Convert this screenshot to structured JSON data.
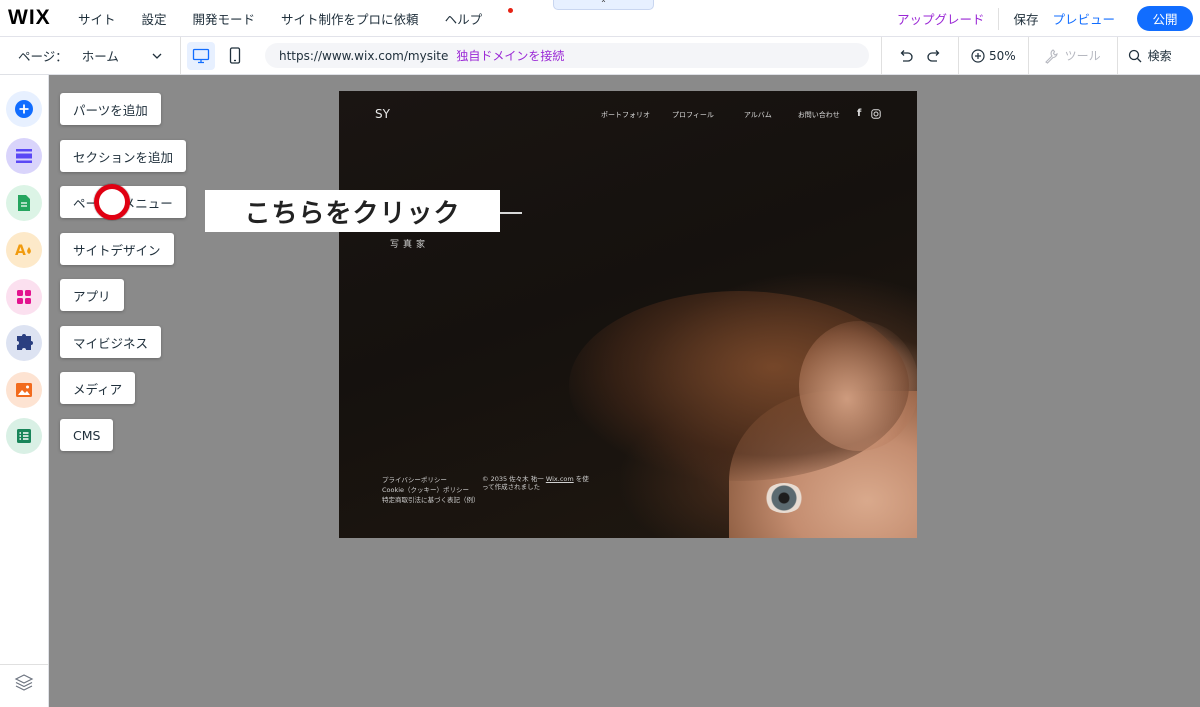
{
  "topbar": {
    "logo": "WIX",
    "menu": [
      "サイト",
      "設定",
      "開発モード",
      "サイト制作をプロに依頼",
      "ヘルプ"
    ],
    "tab_handle_glyph": "⌃",
    "upgrade": "アップグレード",
    "save": "保存",
    "preview": "プレビュー",
    "publish": "公開"
  },
  "toolbar": {
    "page_label": "ページ：",
    "page_value": "ホーム",
    "url": "https://www.wix.com/mysite",
    "connect_domain": "独自ドメインを接続",
    "zoom": "50%",
    "tools": "ツール",
    "search": "検索"
  },
  "rail": {
    "items": [
      {
        "name": "add",
        "color": "#116dff"
      },
      {
        "name": "sections",
        "color": "#5a48f5"
      },
      {
        "name": "pages",
        "color": "#25a55f"
      },
      {
        "name": "design",
        "color": "#f19b0f"
      },
      {
        "name": "apps",
        "color": "#e3128f"
      },
      {
        "name": "business",
        "color": "#2b3f80"
      },
      {
        "name": "media",
        "color": "#f26b1d"
      },
      {
        "name": "cms",
        "color": "#18855a"
      }
    ]
  },
  "panel_buttons": [
    "パーツを追加",
    "セクションを追加",
    "ページ・メニュー",
    "サイトデザイン",
    "アプリ",
    "マイビジネス",
    "メディア",
    "CMS"
  ],
  "callout": "こちらをクリック",
  "site": {
    "logo": "SY",
    "nav": [
      "ポートフォリオ",
      "プロフィール",
      "アルバム",
      "お問い合わせ"
    ],
    "subtitle": "写真家",
    "footer_left": [
      "プライバシーポリシー",
      "Cookie（クッキー）ポリシー",
      "特定商取引法に基づく表記（例）"
    ],
    "footer_right_line1_pre": "© 2035 佐々木 祐一",
    "footer_right_link": "Wix.com",
    "footer_right_line1_post": " を使",
    "footer_right_line2": "って作成されました"
  }
}
